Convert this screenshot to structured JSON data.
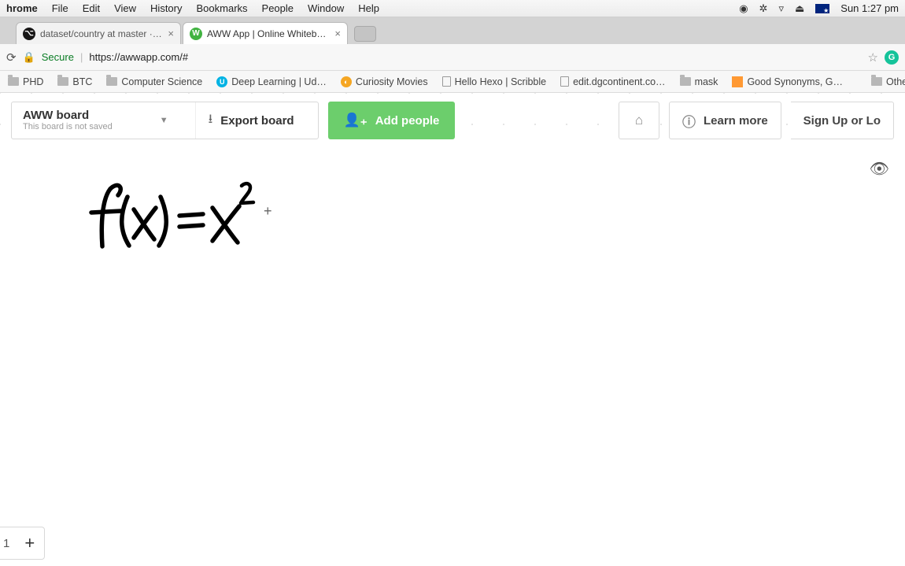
{
  "menubar": {
    "app": "hrome",
    "items": [
      "File",
      "Edit",
      "View",
      "History",
      "Bookmarks",
      "People",
      "Window",
      "Help"
    ],
    "time": "Sun 1:27 pm"
  },
  "tabs": {
    "tab0_title": "dataset/country at master · tpo",
    "tab1_title": "AWW App | Online Whiteboard"
  },
  "addressbar": {
    "secure": "Secure",
    "url": "https://awwapp.com/#"
  },
  "bookmarks": {
    "phd": "PHD",
    "btc": "BTC",
    "cs": "Computer Science",
    "dl": "Deep Learning | Ud…",
    "cur": "Curiosity Movies",
    "hexo": "Hello Hexo | Scribble",
    "dg": "edit.dgcontinent.co…",
    "mask": "mask",
    "syn": "Good Synonyms, G…",
    "other": "Other B"
  },
  "toolbar": {
    "board_title": "AWW board",
    "board_sub": "This board is not saved",
    "export": "Export board",
    "add_people": "Add people",
    "learn_more": "Learn more",
    "signup": "Sign Up or Lo"
  },
  "canvas": {
    "handwriting_desc": "f(x) = x²",
    "zoom_value": "1",
    "zoom_plus": "+"
  }
}
